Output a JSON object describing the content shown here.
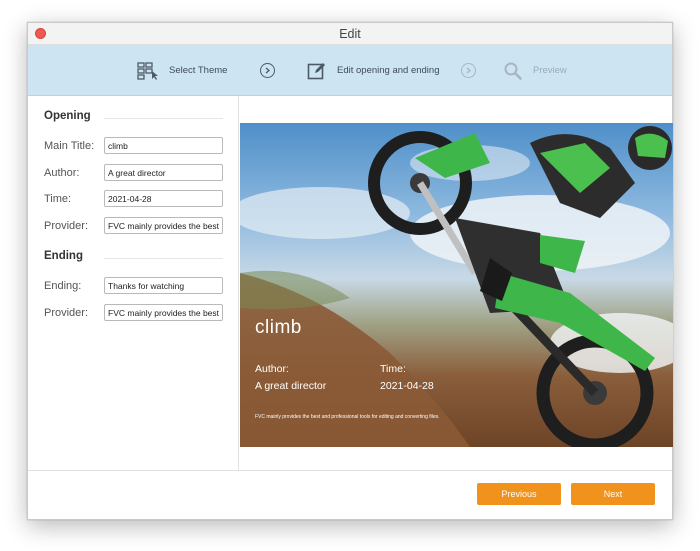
{
  "window": {
    "title": "Edit"
  },
  "steps": [
    {
      "label": "Select Theme",
      "icon": "theme-grid-icon"
    },
    {
      "label": "Edit opening and ending",
      "icon": "edit-icon"
    },
    {
      "label": "Preview",
      "icon": "magnifier-icon"
    }
  ],
  "opening": {
    "section_title": "Opening",
    "fields": [
      {
        "label": "Main Title:",
        "value": "climb"
      },
      {
        "label": "Author:",
        "value": "A great director"
      },
      {
        "label": "Time:",
        "value": "2021-04-28"
      },
      {
        "label": "Provider:",
        "value": "FVC mainly provides the best and professional tools for editing and converting files."
      }
    ]
  },
  "ending": {
    "section_title": "Ending",
    "fields": [
      {
        "label": "Ending:",
        "value": "Thanks for watching"
      },
      {
        "label": "Provider:",
        "value": "FVC mainly provides the best and professional tools for editing and converting files."
      }
    ]
  },
  "preview": {
    "title": "climb",
    "author_label": "Author:",
    "author_value": "A great director",
    "time_label": "Time:",
    "time_value": "2021-04-28",
    "provider_text": "FVC mainly provides the best and professional tools for editing and converting files."
  },
  "buttons": {
    "previous": "Previous",
    "next": "Next"
  },
  "colors": {
    "accent": "#f0921c",
    "stepbar_bg": "#cde4f3",
    "close": "#ee5a52"
  }
}
